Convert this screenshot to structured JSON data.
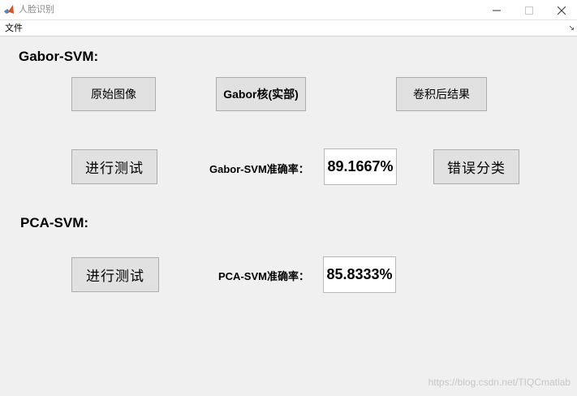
{
  "window": {
    "title": "人脸识别",
    "minimize_icon": "minimize-icon",
    "maximize_icon": "maximize-icon",
    "close_icon": "close-icon"
  },
  "menu": {
    "file": "文件"
  },
  "gabor": {
    "section_label": "Gabor-SVM:",
    "original_button": "原始图像",
    "kernel_button": "Gabor核(实部)",
    "conv_button": "卷积后结果",
    "test_button": "进行测试",
    "accuracy_label": "Gabor-SVM准确率：",
    "accuracy_value": "89.1667%",
    "misclass_button": "错误分类"
  },
  "pca": {
    "section_label": "PCA-SVM:",
    "test_button": "进行测试",
    "accuracy_label": "PCA-SVM准确率：",
    "accuracy_value": "85.8333%"
  },
  "watermark": "https://blog.csdn.net/TIQCmatlab"
}
